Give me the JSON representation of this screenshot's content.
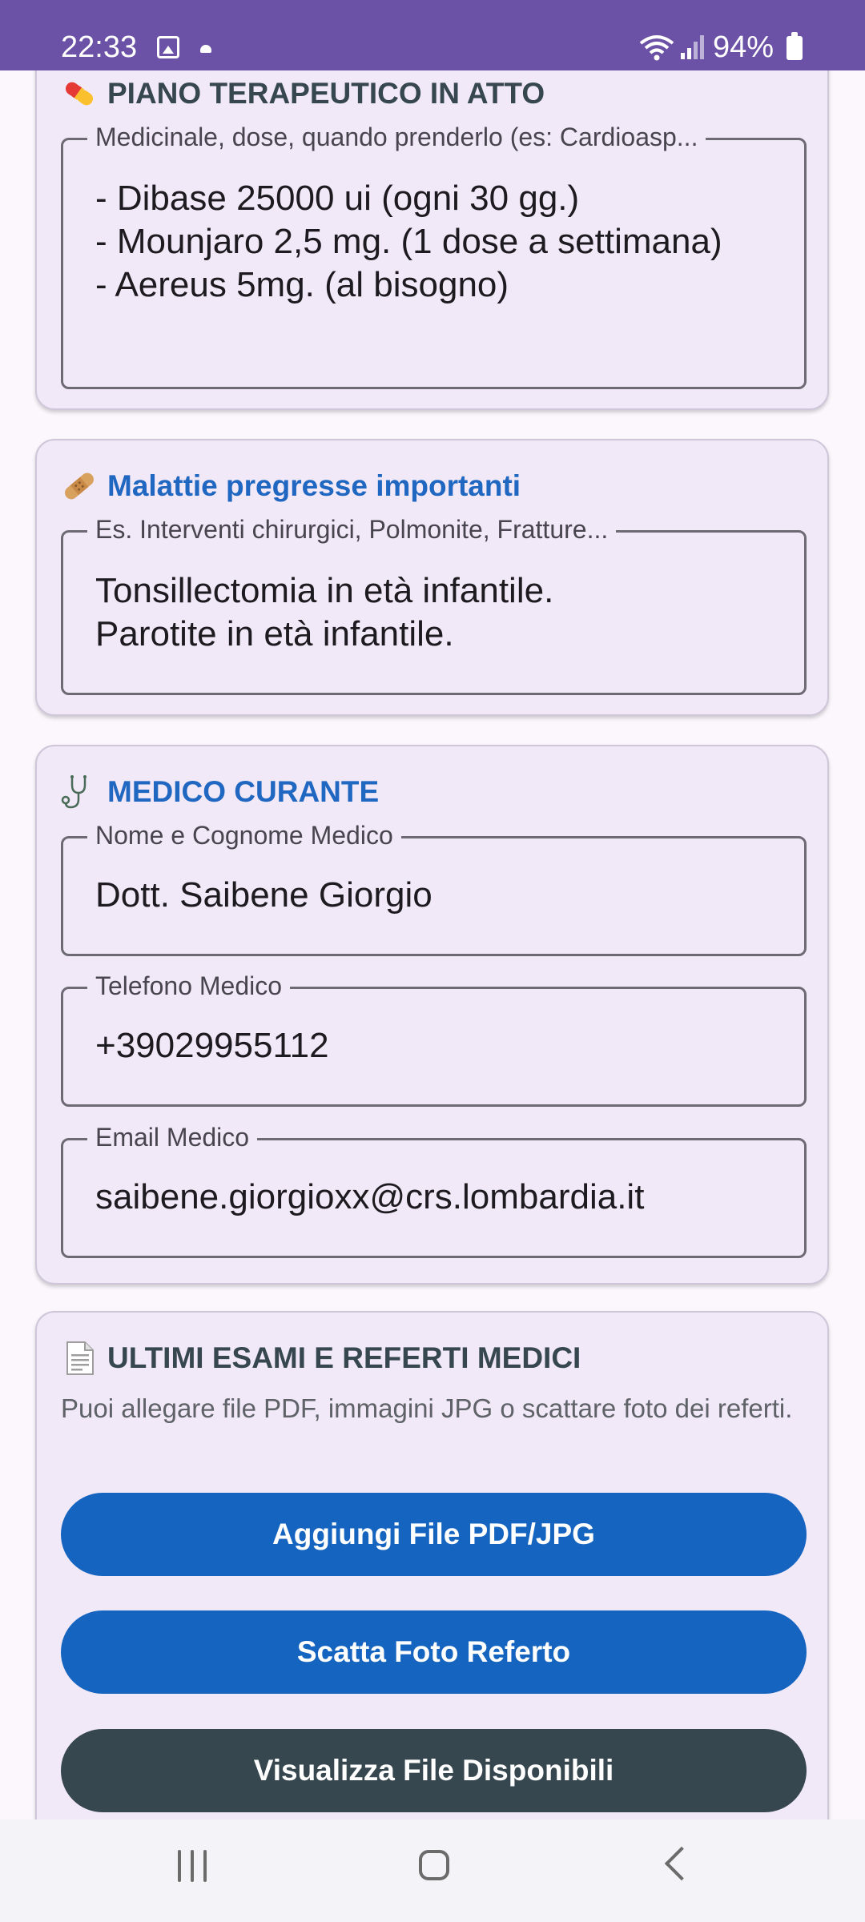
{
  "status_bar": {
    "time": "22:33",
    "battery": "94%",
    "icons": [
      "image-icon",
      "notification-dot-icon",
      "wifi-icon",
      "signal-icon",
      "battery-icon"
    ]
  },
  "therapy": {
    "icon": "pill-icon",
    "title": "PIANO TERAPEUTICO IN ATTO",
    "field_label": "Medicinale, dose, quando prenderlo (es: Cardioasp...",
    "field_value": "- Dibase 25000 ui  (ogni 30 gg.)\n- Mounjaro 2,5 mg.  (1 dose a settimana)\n- Aereus 5mg.   (al bisogno)"
  },
  "past_illnesses": {
    "icon": "bandage-icon",
    "title": "Malattie pregresse importanti",
    "field_label": "Es. Interventi chirurgici, Polmonite, Fratture...",
    "field_value": "Tonsillectomia in età infantile.\nParotite in età infantile."
  },
  "doctor": {
    "icon": "stethoscope-icon",
    "title": "MEDICO CURANTE",
    "name_label": "Nome e Cognome Medico",
    "name_value": "Dott. Saibene Giorgio",
    "phone_label": "Telefono Medico",
    "phone_value": "+39029955112",
    "email_label": "Email Medico",
    "email_value": "saibene.giorgioxx@crs.lombardia.it"
  },
  "exams": {
    "icon": "document-icon",
    "title": "ULTIMI ESAMI E REFERTI MEDICI",
    "description": "Puoi allegare file PDF, immagini JPG o scattare foto dei referti.",
    "add_file_button": "Aggiungi File PDF/JPG",
    "take_photo_button": "Scatta Foto Referto",
    "view_files_button": "Visualizza File Disponibili"
  },
  "colors": {
    "status_bar": "#6b52a6",
    "card_background": "#f1e8f8",
    "title_blue": "#1f67c0",
    "button_blue": "#1565c0",
    "button_dark": "#37474f"
  },
  "nav_bar": {
    "icons": [
      "recent-apps-icon",
      "home-icon",
      "back-icon"
    ]
  }
}
